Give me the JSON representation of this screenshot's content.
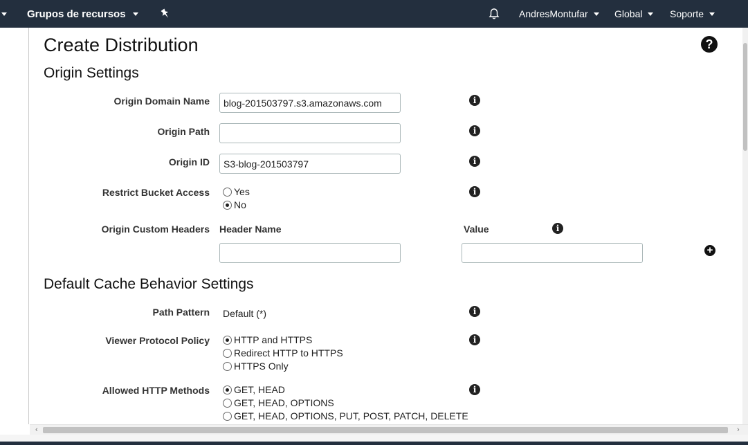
{
  "topnav": {
    "back_glyph": "⌄",
    "resource_groups": "Grupos de recursos",
    "pin_icon": "pin-icon",
    "user": "AndresMontufar",
    "region": "Global",
    "support": "Soporte"
  },
  "page": {
    "title": "Create Distribution",
    "help_glyph": "?"
  },
  "origin": {
    "heading": "Origin Settings",
    "domain_label": "Origin Domain Name",
    "domain_value": "blog-201503797.s3.amazonaws.com",
    "path_label": "Origin Path",
    "path_value": "",
    "id_label": "Origin ID",
    "id_value": "S3-blog-201503797",
    "restrict_label": "Restrict Bucket Access",
    "restrict_options": [
      "Yes",
      "No"
    ],
    "restrict_selected": "No",
    "custom_headers_label": "Origin Custom Headers",
    "header_name_col": "Header Name",
    "value_col": "Value",
    "header_name_value": "",
    "header_value_value": ""
  },
  "cache": {
    "heading": "Default Cache Behavior Settings",
    "path_pattern_label": "Path Pattern",
    "path_pattern_value": "Default (*)",
    "viewer_policy_label": "Viewer Protocol Policy",
    "viewer_options": [
      "HTTP and HTTPS",
      "Redirect HTTP to HTTPS",
      "HTTPS Only"
    ],
    "viewer_selected": "HTTP and HTTPS",
    "methods_label": "Allowed HTTP Methods",
    "methods_options": [
      "GET, HEAD",
      "GET, HEAD, OPTIONS",
      "GET, HEAD, OPTIONS, PUT, POST, PATCH, DELETE"
    ],
    "methods_selected": "GET, HEAD"
  },
  "icons": {
    "info": "i",
    "plus": "+"
  }
}
